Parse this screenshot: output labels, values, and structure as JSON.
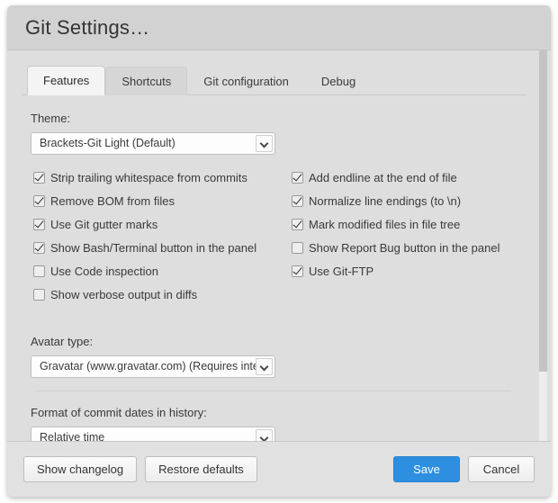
{
  "dialog": {
    "title": "Git Settings…"
  },
  "tabs": [
    {
      "label": "Features",
      "state": "active"
    },
    {
      "label": "Shortcuts",
      "state": "hover"
    },
    {
      "label": "Git configuration",
      "state": "normal"
    },
    {
      "label": "Debug",
      "state": "normal"
    }
  ],
  "theme": {
    "label": "Theme:",
    "value": "Brackets-Git Light (Default)",
    "arrow_icon": "chevron-down-icon"
  },
  "features": {
    "left": [
      {
        "label": "Strip trailing whitespace from commits",
        "checked": true
      },
      {
        "label": "Remove BOM from files",
        "checked": true
      },
      {
        "label": "Use Git gutter marks",
        "checked": true
      },
      {
        "label": "Show Bash/Terminal button in the panel",
        "checked": true
      },
      {
        "label": "Use Code inspection",
        "checked": false
      },
      {
        "label": "Show verbose output in diffs",
        "checked": false
      }
    ],
    "right": [
      {
        "label": "Add endline at the end of file",
        "checked": true
      },
      {
        "label": "Normalize line endings (to \\n)",
        "checked": true
      },
      {
        "label": "Mark modified files in file tree",
        "checked": true
      },
      {
        "label": "Show Report Bug button in the panel",
        "checked": false
      },
      {
        "label": "Use Git-FTP",
        "checked": true
      }
    ]
  },
  "avatar": {
    "label": "Avatar type:",
    "value": "Gravatar (www.gravatar.com) (Requires inte",
    "arrow_icon": "chevron-down-icon"
  },
  "dates": {
    "label": "Format of commit dates in history:",
    "value": "Relative time",
    "arrow_icon": "chevron-down-icon"
  },
  "footer": {
    "show_changelog": "Show changelog",
    "restore_defaults": "Restore defaults",
    "save": "Save",
    "cancel": "Cancel"
  },
  "colors": {
    "primary": "#2e8fe0",
    "dialog_bg": "#dedede",
    "titlebar_bg": "#d2d2d2",
    "footer_bg": "#e1e1e1"
  }
}
